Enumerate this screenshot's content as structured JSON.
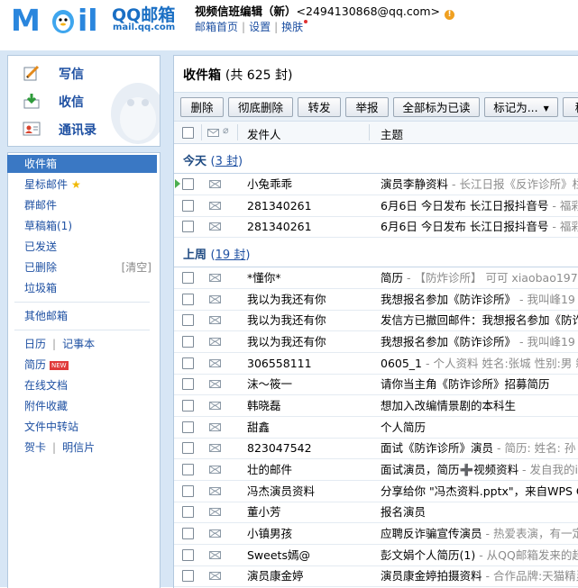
{
  "header": {
    "brand": "QQ邮箱",
    "brand_url": "mail.qq.com",
    "account_name": "视频信班编辑（新）",
    "account_email": "<2494130868@qq.com>",
    "warn_glyph": "!",
    "links": [
      "邮箱首页",
      "设置",
      "换肤"
    ]
  },
  "actions": {
    "write": "写信",
    "receive": "收信",
    "contacts": "通讯录"
  },
  "nav": {
    "inbox": "收件箱",
    "starred": "星标邮件",
    "group": "群邮件",
    "drafts": "草稿箱(1)",
    "sent": "已发送",
    "deleted": "已删除",
    "clear": "[清空]",
    "spam": "垃圾箱",
    "other": "其他邮箱",
    "calendar": "日历",
    "notes": "记事本",
    "resume": "简历",
    "new_badge": "NEW",
    "online_docs": "在线文档",
    "attachments": "附件收藏",
    "file_transfer": "文件中转站",
    "cards": "贺卡",
    "postcards": "明信片"
  },
  "main": {
    "title": "收件箱",
    "count": "(共 625 封)",
    "toolbar": [
      "删除",
      "彻底删除",
      "转发",
      "举报",
      "全部标为已读",
      "标记为...",
      "移"
    ],
    "columns": {
      "from": "发件人",
      "subject": "主题"
    },
    "groups": [
      {
        "label": "今天",
        "count": "3 封"
      },
      {
        "label": "上周",
        "count": "19 封"
      }
    ],
    "today": [
      {
        "from": "小兔乖乖",
        "subject": "演员李静资料",
        "preview": " - 长江日报《反诈诊所》栏目"
      },
      {
        "from": "281340261",
        "subject": "6月6日 今日发布 长江日报抖音号",
        "preview": " - 福彩代"
      },
      {
        "from": "281340261",
        "subject": "6月6日 今日发布 长江日报抖音号",
        "preview": " - 福彩代"
      }
    ],
    "lastweek": [
      {
        "from": "*懂你*",
        "subject": "简历",
        "preview": " - 【防炸诊所】 可可 xiaobao1974"
      },
      {
        "from": "我以为我还有你",
        "subject": "我想报名参加《防诈诊所》",
        "preview": " - 我叫峰19"
      },
      {
        "from": "我以为我还有你",
        "subject": "发信方已撤回邮件：我想报名参加《防诈诊"
      },
      {
        "from": "我以为我还有你",
        "subject": "我想报名参加《防诈诊所》",
        "preview": " - 我叫峰19"
      },
      {
        "from": "306558111",
        "subject": "0605_1",
        "preview": " - 个人资料 姓名:张城 性别:男 籍"
      },
      {
        "from": "沫～筱一",
        "subject": "请你当主角《防诈诊所》招募简历"
      },
      {
        "from": "韩晓磊",
        "subject": "想加入改编情景剧的本科生"
      },
      {
        "from": "甜鑫",
        "subject": "个人简历"
      },
      {
        "from": "823047542",
        "subject": "面试《防诈诊所》演员",
        "preview": " - 简历: 姓名: 孙"
      },
      {
        "from": "壮的邮件",
        "subject": "面试演员，简历➕视频资料",
        "preview": " - 发自我的iP"
      },
      {
        "from": "冯杰演员资料",
        "subject": "分享给你 \"冯杰资料.pptx\"，来自WPS Of"
      },
      {
        "from": "董小芳",
        "subject": "报名演员"
      },
      {
        "from": "小镇男孩",
        "subject": "应聘反诈骗宣传演员",
        "preview": " - 热爱表演，有一定"
      },
      {
        "from": "Sweets嫣@",
        "subject": "彭文娟个人简历(1)",
        "preview": " - 从QQ邮箱发来的超"
      },
      {
        "from": "演员康金婷",
        "subject": "演员康金婷拍摄资料",
        "preview": " - 合作品牌:天猫精灵"
      }
    ]
  }
}
